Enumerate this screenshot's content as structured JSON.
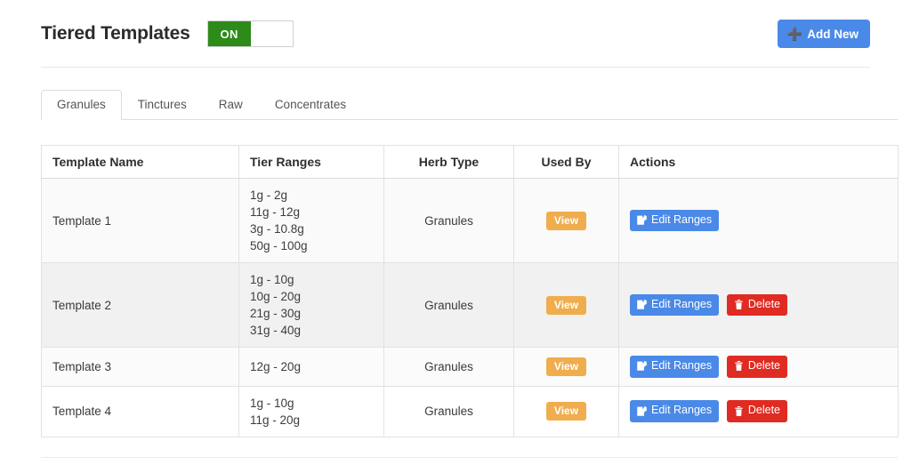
{
  "header": {
    "title": "Tiered Templates",
    "toggle": {
      "name": "tiered-templates-toggle",
      "state_label": "ON",
      "on_color": "#2d8b19"
    },
    "add_new": {
      "label": "Add New",
      "icon": "plus-icon",
      "color": "#4a89e8"
    }
  },
  "tabs": [
    {
      "label": "Granules",
      "active": true
    },
    {
      "label": "Tinctures",
      "active": false
    },
    {
      "label": "Raw",
      "active": false
    },
    {
      "label": "Concentrates",
      "active": false
    }
  ],
  "table": {
    "columns": [
      {
        "label": "Template Name",
        "align": "left"
      },
      {
        "label": "Tier Ranges",
        "align": "left"
      },
      {
        "label": "Herb Type",
        "align": "center"
      },
      {
        "label": "Used By",
        "align": "center"
      },
      {
        "label": "Actions",
        "align": "left"
      }
    ],
    "rows": [
      {
        "name": "Template 1",
        "ranges": [
          "1g - 2g",
          "11g - 12g",
          "3g - 10.8g",
          "50g - 100g"
        ],
        "herb_type": "Granules",
        "used_by": "View",
        "actions": [
          "Edit Ranges"
        ]
      },
      {
        "name": "Template 2",
        "ranges": [
          "1g - 10g",
          "10g - 20g",
          "21g - 30g",
          "31g - 40g"
        ],
        "herb_type": "Granules",
        "used_by": "View",
        "actions": [
          "Edit Ranges",
          "Delete"
        ]
      },
      {
        "name": "Template 3",
        "ranges": [
          "12g - 20g"
        ],
        "herb_type": "Granules",
        "used_by": "View",
        "actions": [
          "Edit Ranges",
          "Delete"
        ]
      },
      {
        "name": "Template 4",
        "ranges": [
          "1g - 10g",
          "11g - 20g"
        ],
        "herb_type": "Granules",
        "used_by": "View",
        "actions": [
          "Edit Ranges",
          "Delete"
        ]
      }
    ],
    "action_labels": {
      "edit": "Edit Ranges",
      "delete": "Delete"
    },
    "badge_color": "#f0ad4e",
    "edit_color": "#4a89e8",
    "delete_color": "#e02b22"
  }
}
